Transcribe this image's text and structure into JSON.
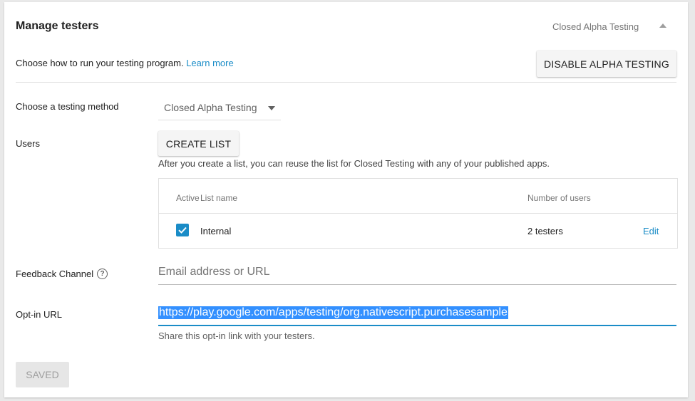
{
  "header": {
    "title": "Manage testers",
    "status": "Closed Alpha Testing"
  },
  "intro": {
    "text": "Choose how to run your testing program.",
    "link": "Learn more"
  },
  "buttons": {
    "disable": "Disable Alpha Testing",
    "create_list": "Create List",
    "saved": "Saved"
  },
  "method": {
    "label": "Choose a testing method",
    "selected": "Closed Alpha Testing"
  },
  "users": {
    "label": "Users",
    "note": "After you create a list, you can reuse the list for Closed Testing with any of your published apps.",
    "columns": [
      "Active",
      "List name",
      "Number of users"
    ],
    "rows": [
      {
        "active": true,
        "name": "Internal",
        "count": "2 testers",
        "action": "Edit"
      }
    ]
  },
  "feedback": {
    "label": "Feedback Channel",
    "placeholder": "Email address or URL",
    "value": ""
  },
  "optin": {
    "label": "Opt-in URL",
    "value": "https://play.google.com/apps/testing/org.nativescript.purchasesample",
    "help": "Share this opt-in link with your testers."
  },
  "colors": {
    "accent": "#1a8cc7",
    "selection": "#3390ff"
  },
  "icons": {
    "collapse": "chevron-up-icon",
    "dropdown": "caret-down-icon",
    "check": "checkmark-icon",
    "help": "question-circle-icon"
  }
}
